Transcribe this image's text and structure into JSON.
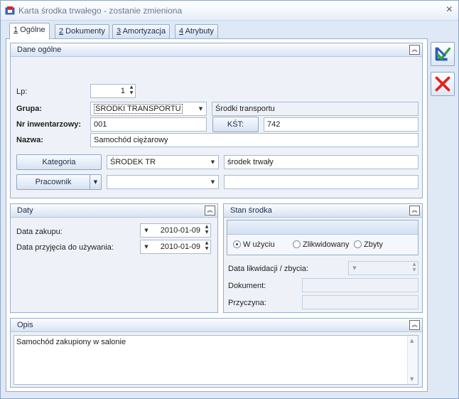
{
  "window": {
    "title": "Karta środka trwałego - zostanie zmieniona",
    "close_label": "×"
  },
  "tabs": [
    {
      "key": "1",
      "label": " Ogólne"
    },
    {
      "key": "2",
      "label": " Dokumenty"
    },
    {
      "key": "3",
      "label": " Amortyzacja"
    },
    {
      "key": "4",
      "label": " Atrybuty"
    }
  ],
  "general": {
    "header": "Dane ogólne",
    "lp_label": "Lp:",
    "lp_value": "1",
    "grupa_label": "Grupa:",
    "grupa_value": "ŚRODKI TRANSPORTU",
    "grupa_desc": "Środki transportu",
    "nr_label": "Nr inwentarzowy:",
    "nr_value": "001",
    "kst_button": "KŚT:",
    "kst_value": "742",
    "nazwa_label": "Nazwa:",
    "nazwa_value": "Samochód ciężarowy",
    "kategoria_button": "Kategoria",
    "kategoria_value": "ŚRODEK TR",
    "kategoria_desc": "środek trwały",
    "pracownik_button": "Pracownik",
    "pracownik_value": "",
    "pracownik_desc": ""
  },
  "daty": {
    "header": "Daty",
    "zakup_label": "Data zakupu:",
    "zakup_value": "2010-01-09",
    "przyjecie_label": "Data przyjęcia do używania:",
    "przyjecie_value": "2010-01-09"
  },
  "stan": {
    "header": "Stan środka",
    "options": [
      "W użyciu",
      "Zlikwidowany",
      "Zbyty"
    ],
    "selected": "W użyciu",
    "likwidacja_label": "Data likwidacji / zbycia:",
    "dokument_label": "Dokument:",
    "przyczyna_label": "Przyczyna:"
  },
  "opis": {
    "header": "Opis",
    "text": "Samochód zakupiony w salonie"
  },
  "icons": {
    "collapse": "collapse-up-icon",
    "save": "save-icon",
    "cancel": "cancel-icon"
  },
  "colors": {
    "accent": "#97aeca",
    "cancel": "#e2231a",
    "save": "#2a5cb8"
  }
}
